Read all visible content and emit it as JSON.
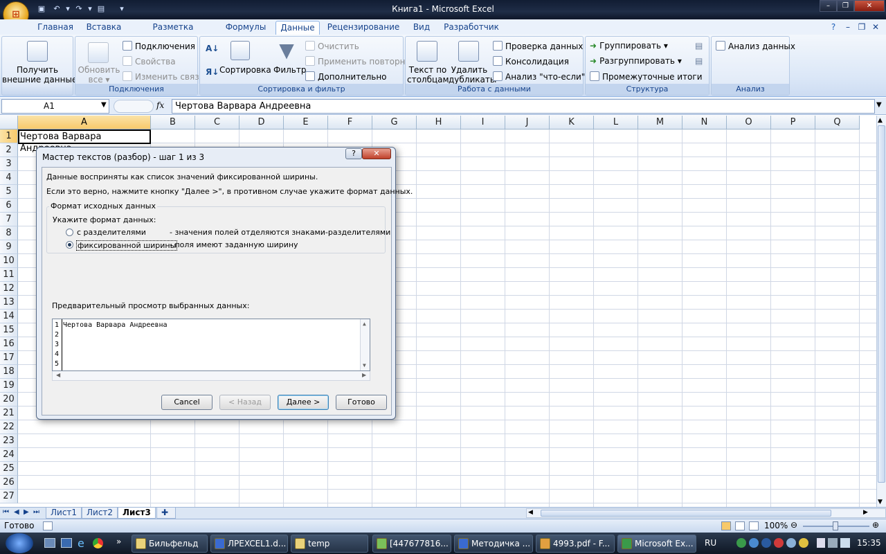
{
  "window": {
    "title": "Книга1 - Microsoft Excel"
  },
  "ribbon_tabs": [
    "Главная",
    "Вставка",
    "Разметка страницы",
    "Формулы",
    "Данные",
    "Рецензирование",
    "Вид",
    "Разработчик"
  ],
  "active_tab": "Данные",
  "groups": {
    "get_external": {
      "btn": "Получить",
      "btn2": "внешние данные"
    },
    "connections": {
      "label": "Подключения",
      "refresh": "Обновить",
      "refresh2": "все",
      "items": [
        "Подключения",
        "Свойства",
        "Изменить связи"
      ]
    },
    "sort_filter": {
      "label": "Сортировка и фильтр",
      "sort": "Сортировка",
      "filter": "Фильтр",
      "items": [
        "Очистить",
        "Применить повторно",
        "Дополнительно"
      ]
    },
    "data_tools": {
      "label": "Работа с данными",
      "text_to_cols": "Текст по",
      "text_to_cols2": "столбцам",
      "remove_dup": "Удалить",
      "remove_dup2": "дубликаты",
      "items": [
        "Проверка данных",
        "Консолидация",
        "Анализ \"что-если\""
      ]
    },
    "outline": {
      "label": "Структура",
      "items": [
        "Группировать",
        "Разгруппировать",
        "Промежуточные итоги"
      ]
    },
    "analysis": {
      "label": "Анализ",
      "item": "Анализ данных"
    }
  },
  "formula_bar": {
    "name_box": "A1",
    "fx": "fx",
    "content": "Чертова Варвара Андреевна"
  },
  "columns": [
    "A",
    "B",
    "C",
    "D",
    "E",
    "F",
    "G",
    "H",
    "I",
    "J",
    "K",
    "L",
    "M",
    "N",
    "O",
    "P",
    "Q"
  ],
  "rows": [
    "1",
    "2",
    "3",
    "4",
    "5",
    "6",
    "7",
    "8",
    "9",
    "10",
    "11",
    "12",
    "13",
    "14",
    "15",
    "16",
    "17",
    "18",
    "19",
    "20",
    "21",
    "22",
    "23",
    "24",
    "25",
    "26",
    "27"
  ],
  "cell_A1": "Чертова Варвара Андреевна",
  "sheets": [
    "Лист1",
    "Лист2",
    "Лист3"
  ],
  "active_sheet": "Лист3",
  "status": {
    "ready": "Готово",
    "zoom": "100%"
  },
  "dialog": {
    "title": "Мастер текстов (разбор) - шаг 1 из 3",
    "line1": "Данные восприняты как список значений фиксированной ширины.",
    "line2": "Если это верно, нажмите кнопку \"Далее >\", в противном случае укажите формат данных.",
    "group_title": "Формат исходных данных",
    "prompt": "Укажите формат данных:",
    "opt1_label": "с разделителями",
    "opt1_desc": "- значения полей отделяются знаками-разделителями",
    "opt2_label": "фиксированной ширины",
    "opt2_desc": "- поля имеют заданную ширину",
    "selected_option": "фиксированной ширины",
    "preview_label": "Предварительный просмотр выбранных данных:",
    "preview_lines": [
      "Чертова Варвара Андреевна",
      "",
      "",
      "",
      ""
    ],
    "preview_nums": [
      "1",
      "2",
      "3",
      "4",
      "5"
    ],
    "buttons": {
      "cancel": "Cancel",
      "back": "< Назад",
      "next": "Далее >",
      "finish": "Готово"
    }
  },
  "taskbar": {
    "items": [
      "Бильфельд",
      "ЛРEXCEL1.d...",
      "temp",
      "[447677816...",
      "Методичка ...",
      "4993.pdf - F...",
      "Microsoft Ex..."
    ],
    "active": "Microsoft Ex...",
    "lang": "RU",
    "clock": "15:35"
  }
}
